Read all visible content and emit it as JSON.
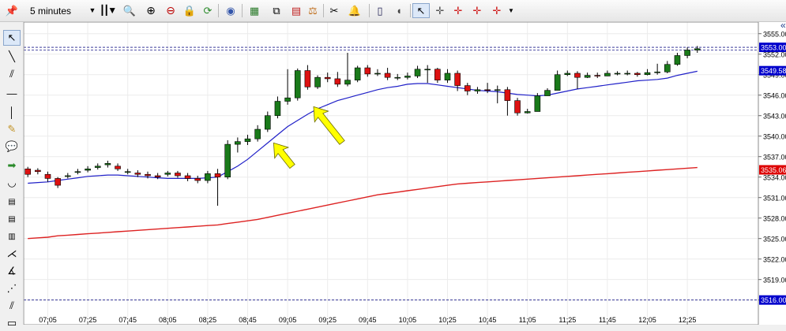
{
  "toolbar": {
    "timeframe": "5 minutes",
    "icons": [
      "pin-icon",
      "caret-down-icon",
      "candlestick-icon",
      "magnifier-icon",
      "zoom-in-icon",
      "zoom-out-icon",
      "lock-icon",
      "refresh-icon",
      "eye-icon",
      "indicator-chart-icon",
      "tree-icon",
      "scale-icon",
      "scissors-icon",
      "bell-icon",
      "phone-icon",
      "mouse-icon",
      "cursor-arrow-icon",
      "crosshair-icon",
      "crosshair-red-icon",
      "crosshair-red-arrow-icon",
      "overflow-icon"
    ]
  },
  "sidebar": {
    "icons": [
      "pointer-icon",
      "line-icon",
      "channel-icon",
      "horizontal-line-icon",
      "vertical-line-icon",
      "note-icon",
      "speech-bubble-icon",
      "arrow-icon",
      "arc-icon",
      "grid-icon",
      "grid-2-icon",
      "fibonacci-icon",
      "pitchfork-icon",
      "angle-icon",
      "fan-icon",
      "parallel-icon",
      "rectangle-icon"
    ]
  },
  "chart_data": {
    "type": "candlestick",
    "x": [
      "06:55",
      "07:00",
      "07:05",
      "07:10",
      "07:15",
      "07:20",
      "07:25",
      "07:30",
      "07:35",
      "07:40",
      "07:45",
      "07:50",
      "07:55",
      "08:00",
      "08:05",
      "08:10",
      "08:15",
      "08:20",
      "08:25",
      "08:30",
      "08:35",
      "08:40",
      "08:45",
      "08:50",
      "08:55",
      "09:00",
      "09:05",
      "09:10",
      "09:15",
      "09:20",
      "09:25",
      "09:30",
      "09:35",
      "09:40",
      "09:45",
      "09:50",
      "09:55",
      "10:00",
      "10:05",
      "10:10",
      "10:15",
      "10:20",
      "10:25",
      "10:30",
      "10:35",
      "10:40",
      "10:45",
      "10:50",
      "10:55",
      "11:00",
      "11:05",
      "11:10",
      "11:15",
      "11:20",
      "11:25",
      "11:30",
      "11:35",
      "11:40",
      "11:45",
      "11:50",
      "11:55",
      "12:00",
      "12:05",
      "12:10",
      "12:15",
      "12:20",
      "12:25",
      "12:30",
      "12:35"
    ],
    "series": [
      {
        "open": [
          3535.2,
          3535.0,
          3534.4,
          3533.8,
          3534.2,
          3534.8,
          3535.0,
          3535.4,
          3535.8,
          3535.6,
          3534.8,
          3534.6,
          3534.4,
          3534.2,
          3534.4,
          3534.6,
          3534.2,
          3533.8,
          3533.5,
          3534.5,
          3534.0,
          3538.8,
          3539.2,
          3539.6,
          3541.0,
          3543.0,
          3545.1,
          3545.6,
          3549.6,
          3547.2,
          3548.6,
          3548.4,
          3547.6,
          3548.2,
          3550.0,
          3549.1,
          3549.2,
          3548.6,
          3548.6,
          3548.8,
          3549.8,
          3549.8,
          3548.2,
          3549.2,
          3547.4,
          3546.6,
          3546.8,
          3546.7,
          3546.8,
          3545.2,
          3543.4,
          3543.6,
          3545.9,
          3546.7,
          3549.0,
          3549.2,
          3548.6,
          3548.9,
          3548.8,
          3549.2,
          3549.2,
          3549.2,
          3549.0,
          3549.3,
          3549.4,
          3550.5,
          3551.8,
          3552.6
        ],
        "close": [
          3534.4,
          3534.8,
          3533.8,
          3532.8,
          3534.2,
          3534.8,
          3535.2,
          3535.6,
          3536.0,
          3535.2,
          3534.8,
          3534.4,
          3534.2,
          3534.0,
          3534.6,
          3534.2,
          3533.8,
          3533.5,
          3534.5,
          3534.0,
          3538.8,
          3539.2,
          3539.6,
          3541.0,
          3543.0,
          3545.1,
          3545.6,
          3549.6,
          3547.2,
          3548.6,
          3548.4,
          3547.6,
          3548.2,
          3550.0,
          3549.1,
          3549.2,
          3548.6,
          3548.6,
          3548.8,
          3549.8,
          3549.8,
          3548.2,
          3549.2,
          3547.4,
          3546.6,
          3546.8,
          3546.7,
          3546.8,
          3545.2,
          3543.4,
          3543.6,
          3545.9,
          3546.7,
          3549.0,
          3549.2,
          3548.6,
          3548.9,
          3548.8,
          3549.2,
          3549.2,
          3549.2,
          3549.0,
          3549.3,
          3549.4,
          3550.5,
          3551.8,
          3552.6,
          3552.8
        ],
        "high": [
          3535.5,
          3535.3,
          3534.8,
          3534.0,
          3534.6,
          3535.2,
          3535.6,
          3536.0,
          3536.4,
          3536.0,
          3535.2,
          3535.0,
          3534.8,
          3534.6,
          3534.9,
          3534.9,
          3534.6,
          3534.2,
          3534.9,
          3535.2,
          3539.4,
          3539.8,
          3540.2,
          3541.6,
          3543.6,
          3545.8,
          3549.8,
          3549.9,
          3550.4,
          3548.9,
          3549.3,
          3549.4,
          3552.2,
          3550.3,
          3550.4,
          3549.8,
          3550.0,
          3549.1,
          3549.3,
          3550.3,
          3550.4,
          3550.0,
          3549.8,
          3549.6,
          3547.8,
          3547.2,
          3547.8,
          3547.4,
          3547.2,
          3545.6,
          3544.0,
          3546.3,
          3547.0,
          3549.6,
          3549.6,
          3549.5,
          3549.3,
          3549.3,
          3549.6,
          3549.5,
          3549.6,
          3549.4,
          3549.8,
          3550.6,
          3551.0,
          3552.2,
          3553.0,
          3553.2
        ],
        "low": [
          3534.0,
          3534.4,
          3533.3,
          3532.4,
          3533.8,
          3534.4,
          3534.7,
          3535.1,
          3535.4,
          3534.9,
          3534.4,
          3534.0,
          3533.8,
          3533.7,
          3534.1,
          3533.9,
          3533.4,
          3533.1,
          3533.1,
          3529.8,
          3533.7,
          3537.6,
          3538.7,
          3539.2,
          3540.6,
          3542.6,
          3544.6,
          3545.2,
          3546.8,
          3546.9,
          3547.9,
          3547.2,
          3547.3,
          3547.9,
          3548.7,
          3548.8,
          3548.2,
          3548.2,
          3548.3,
          3548.5,
          3547.8,
          3547.8,
          3547.8,
          3546.6,
          3546.0,
          3546.2,
          3546.3,
          3544.8,
          3543.0,
          3543.0,
          3543.3,
          3545.5,
          3546.3,
          3548.7,
          3548.8,
          3546.9,
          3548.5,
          3548.5,
          3548.9,
          3548.9,
          3548.9,
          3548.7,
          3548.9,
          3549.0,
          3549.2,
          3550.3,
          3551.4,
          3552.2
        ]
      }
    ],
    "ma_fast": [
      3533.1,
      3533.2,
      3533.3,
      3533.5,
      3533.7,
      3533.9,
      3534.1,
      3534.2,
      3534.3,
      3534.3,
      3534.2,
      3534.1,
      3534.0,
      3533.9,
      3533.8,
      3533.8,
      3533.8,
      3533.8,
      3533.9,
      3534.0,
      3534.8,
      3535.6,
      3536.6,
      3537.8,
      3539.0,
      3540.2,
      3541.4,
      3542.3,
      3543.2,
      3544.0,
      3544.6,
      3545.2,
      3545.6,
      3546.0,
      3546.4,
      3546.8,
      3547.1,
      3547.3,
      3547.6,
      3547.7,
      3547.7,
      3547.5,
      3547.3,
      3547.1,
      3546.9,
      3546.7,
      3546.6,
      3546.5,
      3546.3,
      3546.1,
      3546.0,
      3545.9,
      3546.0,
      3546.3,
      3546.6,
      3546.9,
      3547.1,
      3547.3,
      3547.5,
      3547.7,
      3547.9,
      3548.1,
      3548.2,
      3548.3,
      3548.5,
      3548.9,
      3549.2,
      3549.5
    ],
    "ma_slow": [
      3525.0,
      3525.1,
      3525.2,
      3525.4,
      3525.5,
      3525.6,
      3525.7,
      3525.8,
      3525.9,
      3526.0,
      3526.1,
      3526.2,
      3526.3,
      3526.4,
      3526.5,
      3526.6,
      3526.7,
      3526.8,
      3526.9,
      3527.0,
      3527.2,
      3527.4,
      3527.6,
      3527.8,
      3528.1,
      3528.4,
      3528.7,
      3529.0,
      3529.3,
      3529.6,
      3529.9,
      3530.2,
      3530.5,
      3530.8,
      3531.1,
      3531.4,
      3531.6,
      3531.8,
      3532.0,
      3532.2,
      3532.4,
      3532.6,
      3532.8,
      3533.0,
      3533.1,
      3533.2,
      3533.3,
      3533.4,
      3533.5,
      3533.6,
      3533.7,
      3533.8,
      3533.9,
      3534.0,
      3534.1,
      3534.2,
      3534.3,
      3534.4,
      3534.5,
      3534.6,
      3534.7,
      3534.8,
      3534.9,
      3535.0,
      3535.1,
      3535.2,
      3535.3,
      3535.4
    ],
    "hlines": [
      3553.0,
      3552.6,
      3516.0
    ],
    "price_tags": [
      {
        "label": "3553.00",
        "value": 3553.0,
        "color": "#0000cc"
      },
      {
        "label": "3549.58",
        "value": 3549.58,
        "color": "#0000cc"
      },
      {
        "label": "3535.06",
        "value": 3535.06,
        "color": "#dd0000"
      },
      {
        "label": "3516.00",
        "value": 3516.0,
        "color": "#0000cc"
      }
    ],
    "y_ticks": [
      "3555.00",
      "3552.00",
      "3549.00",
      "3546.00",
      "3543.00",
      "3540.00",
      "3537.00",
      "3534.00",
      "3531.00",
      "3528.00",
      "3525.00",
      "3522.00",
      "3519.00",
      "3516.00"
    ],
    "x_ticks": [
      "07:05",
      "07:25",
      "07:45",
      "08:05",
      "08:25",
      "08:45",
      "09:05",
      "09:25",
      "09:45",
      "10:05",
      "10:25",
      "10:45",
      "11:05",
      "11:25",
      "11:45",
      "12:05",
      "12:25"
    ],
    "ylim": [
      3514.0,
      3556.7
    ],
    "colors": {
      "up": "#1a7a1a",
      "down": "#dd1111",
      "ma_fast": "#2020c8",
      "ma_slow": "#dd2222",
      "arrow": "#ffff00"
    },
    "annotations": [
      "arrow-1",
      "arrow-2"
    ],
    "grid": true
  }
}
